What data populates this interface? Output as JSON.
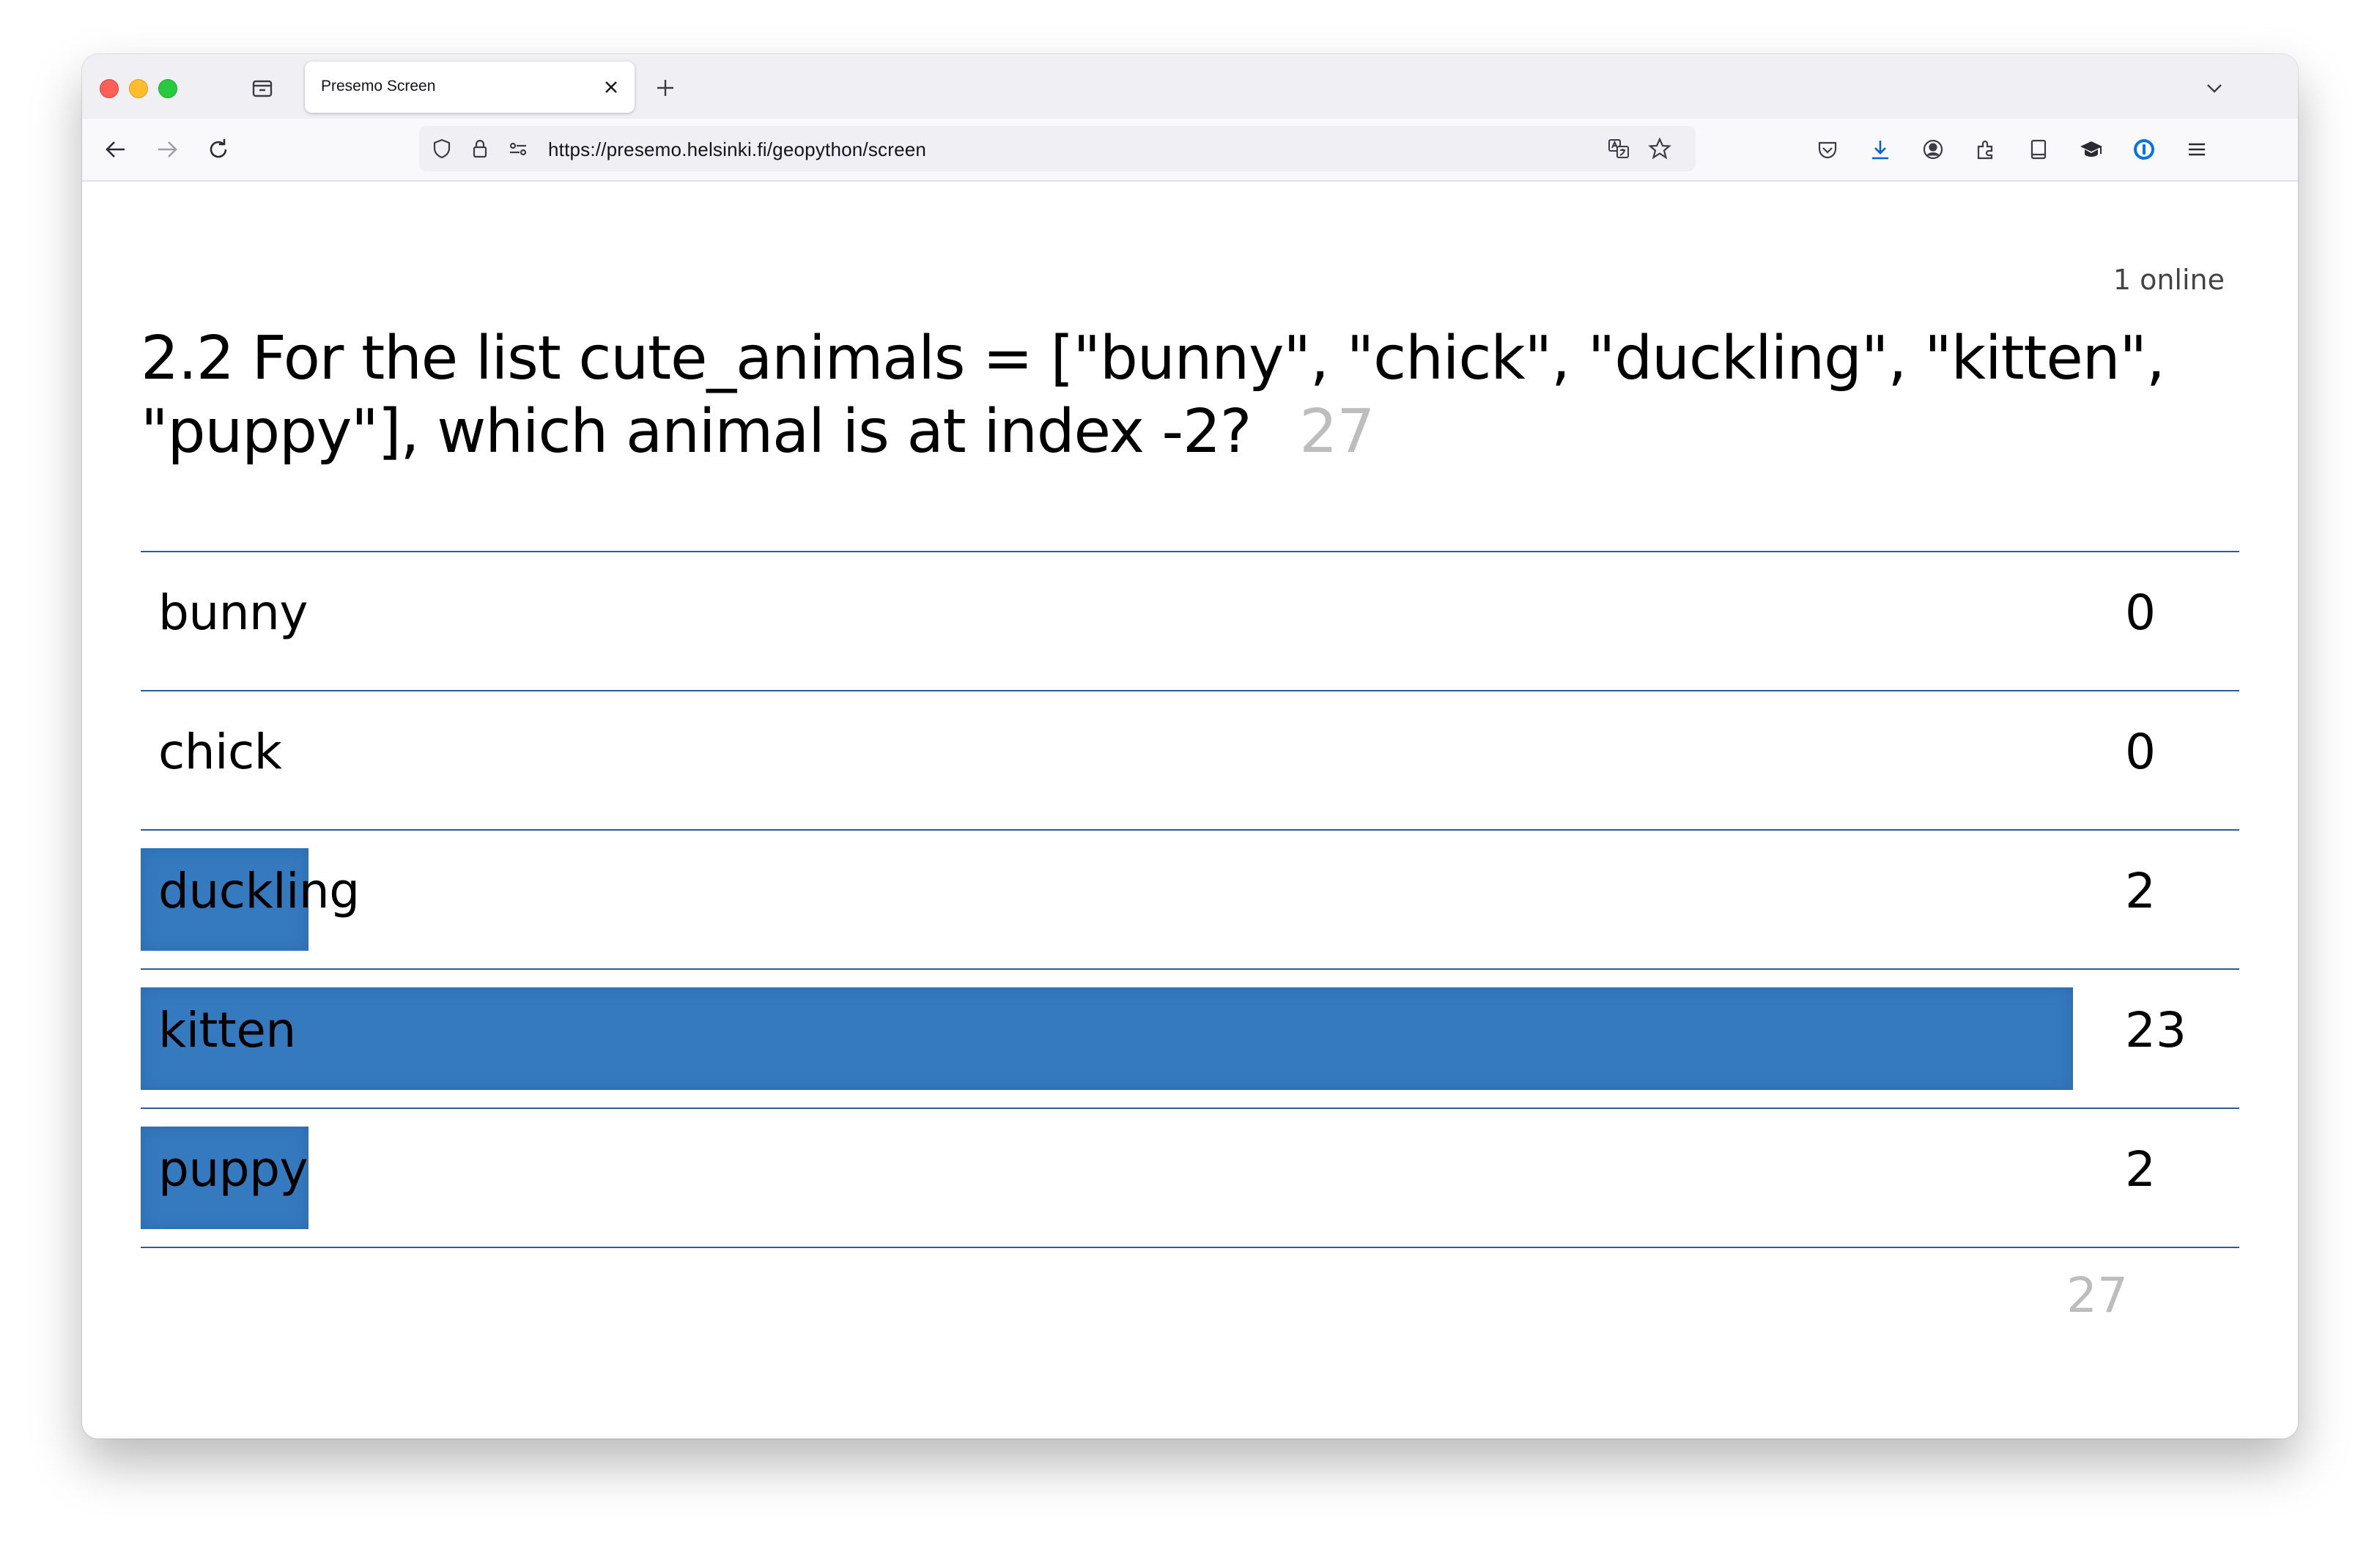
{
  "browser": {
    "tab_title": "Presemo Screen",
    "url": "https://presemo.helsinki.fi/geopython/screen",
    "icons": {
      "tab_list": "tab-list-icon",
      "close": "close-icon",
      "new_tab": "plus-icon",
      "overflow": "chevron-down-icon",
      "back": "arrow-left-icon",
      "forward": "arrow-right-icon",
      "reload": "reload-icon",
      "tracking": "shield-icon",
      "lock": "lock-icon",
      "permissions": "permissions-icon",
      "translate": "translate-icon",
      "bookmark": "star-icon",
      "pocket": "pocket-icon",
      "downloads": "download-icon",
      "account": "account-icon",
      "extensions": "extensions-icon",
      "reader": "reader-icon",
      "education": "mortarboard-icon",
      "password_manager": "password-manager-icon",
      "menu": "hamburger-icon"
    },
    "accent_color": "#0060df"
  },
  "page": {
    "online": "1 online",
    "question": "2.2 For the list cute_animals = [\"bunny\", \"chick\", \"duckling\", \"kitten\", \"puppy\"], which animal is at index -2?",
    "question_count": "27",
    "total": "27",
    "bar_color": "#357abf",
    "rule_color": "#2f5c99"
  },
  "chart_data": {
    "type": "bar",
    "orientation": "horizontal",
    "categories": [
      "bunny",
      "chick",
      "duckling",
      "kitten",
      "puppy"
    ],
    "values": [
      0,
      0,
      2,
      23,
      2
    ],
    "max": 23,
    "total": 27
  }
}
